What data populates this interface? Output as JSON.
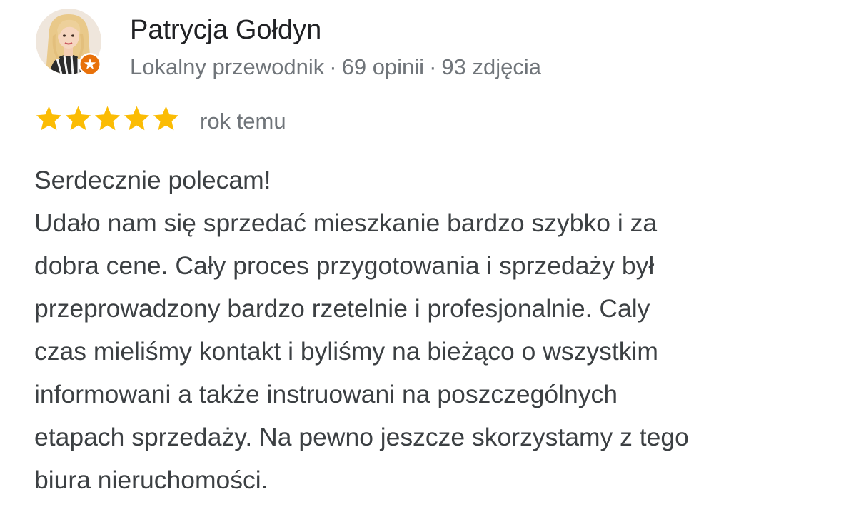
{
  "author": {
    "name": "Patrycja Gołdyn",
    "avatar_icon": "avatar-illustration",
    "badge_icon": "local-guide-badge-icon",
    "level": "Lokalny przewodnik",
    "separator": "·",
    "reviews": "69 opinii",
    "photos": "93 zdjęcia"
  },
  "rating": {
    "stars": 5,
    "max_stars": 5,
    "star_color": "#fbbc04",
    "date": "rok temu"
  },
  "review": {
    "lines": [
      "Serdecznie polecam!",
      "Udało nam się sprzedać mieszkanie bardzo szybko i za",
      "dobra cene. Cały proces przygotowania i sprzedaży był",
      "przeprowadzony bardzo rzetelnie i profesjonalnie. Caly",
      "czas mieliśmy kontakt i byliśmy na bieżąco o wszystkim",
      "informowani a także instruowani na poszczególnych",
      "etapach sprzedaży. Na pewno jeszcze skorzystamy z tego",
      "biura nieruchomości."
    ]
  },
  "colors": {
    "name": "#202124",
    "meta": "#70757a",
    "body": "#3c4043",
    "badge": "#e8710a"
  }
}
